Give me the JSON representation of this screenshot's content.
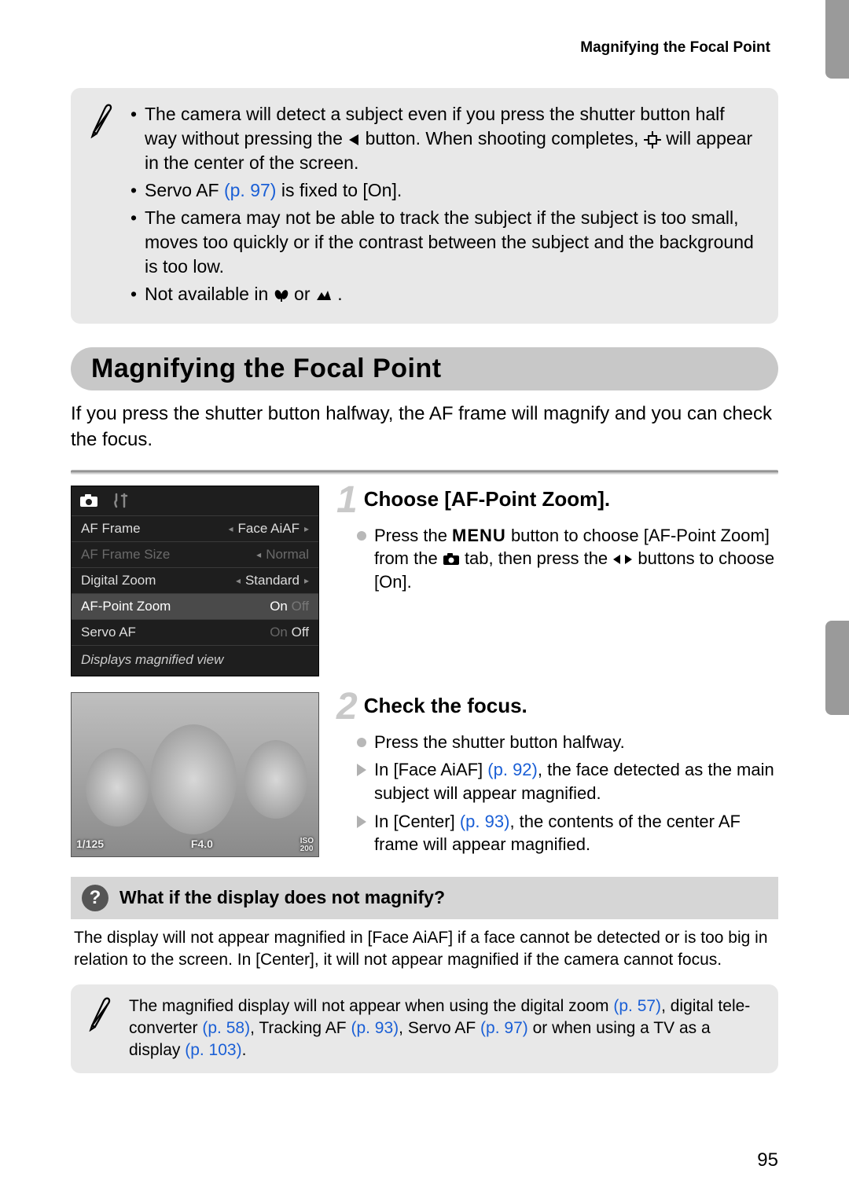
{
  "header": {
    "section_title": "Magnifying the Focal Point"
  },
  "note1": {
    "bullets": {
      "b1_a": "The camera will detect a subject even if you press the shutter button half way without pressing the ",
      "b1_b": " button. When shooting completes, ",
      "b1_c": " will appear in the center of the screen.",
      "b2_a": "Servo AF ",
      "b2_ref": "(p. 97)",
      "b2_b": " is fixed to [On].",
      "b3": "The camera may not be able to track the subject if the subject is too small, moves too quickly or if the contrast between the subject and the background is too low.",
      "b4_a": "Not available in ",
      "b4_b": " or ",
      "b4_c": "."
    }
  },
  "section": {
    "title": "Magnifying the Focal Point",
    "intro": "If you press the shutter button halfway, the AF frame will magnify and you can check the focus."
  },
  "camera_menu": {
    "rows": [
      {
        "label": "AF Frame",
        "value": "Face AiAF",
        "style": "normal"
      },
      {
        "label": "AF Frame Size",
        "value": "Normal",
        "style": "dim"
      },
      {
        "label": "Digital Zoom",
        "value": "Standard",
        "style": "normal"
      },
      {
        "label": "AF-Point Zoom",
        "value_on": "On",
        "value_off": "Off",
        "style": "sel"
      },
      {
        "label": "Servo AF",
        "value_on": "On",
        "value_off": "Off",
        "style": "offsel"
      }
    ],
    "footer": "Displays magnified view"
  },
  "photo_overlay": {
    "left": "1/125",
    "mid": "F4.0",
    "right": "ISO\n200"
  },
  "steps": {
    "s1": {
      "num": "1",
      "title": "Choose [AF-Point Zoom].",
      "p1_a": "Press the ",
      "p1_menu": "MENU",
      "p1_b": " button to choose [AF-Point Zoom] from the ",
      "p1_c": " tab, then press the ",
      "p1_d": " buttons to choose [On]."
    },
    "s2": {
      "num": "2",
      "title": "Check the focus.",
      "p1": "Press the shutter button halfway.",
      "p2_a": "In [Face AiAF] ",
      "p2_ref": "(p. 92)",
      "p2_b": ", the face detected as the main subject will appear magnified.",
      "p3_a": "In [Center] ",
      "p3_ref": "(p. 93)",
      "p3_b": ", the contents of the center AF frame will appear magnified."
    }
  },
  "faq": {
    "question": "What if the display does not magnify?",
    "answer": "The display will not appear magnified in [Face AiAF] if a face cannot be detected or is too big in relation to the screen. In [Center], it will not appear magnified if the camera cannot focus."
  },
  "note2": {
    "a": "The magnified display will not appear when using the digital zoom ",
    "r1": "(p. 57)",
    "b": ", digital tele-converter ",
    "r2": "(p. 58)",
    "c": ", Tracking AF ",
    "r3": "(p. 93)",
    "d": ", Servo AF ",
    "r4": "(p. 97)",
    "e": " or when using a TV as a display ",
    "r5": "(p. 103)",
    "f": "."
  },
  "page_number": "95"
}
